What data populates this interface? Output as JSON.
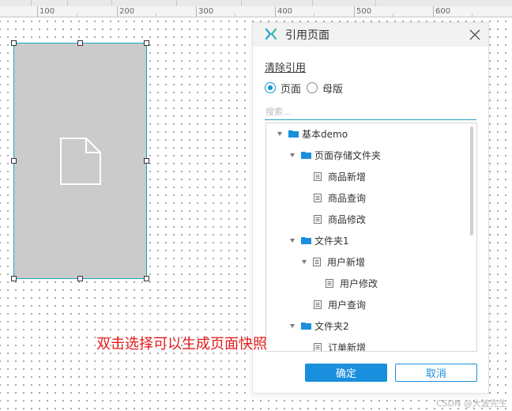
{
  "ruler": {
    "labels": [
      "100",
      "200",
      "300",
      "400",
      "500",
      "600"
    ]
  },
  "dialog": {
    "title": "引用页面",
    "clear_reference": "清除引用",
    "radios": [
      {
        "label": "页面",
        "checked": true
      },
      {
        "label": "母版",
        "checked": false
      }
    ],
    "search_placeholder": "搜索...",
    "tree": [
      {
        "label": "基本demo",
        "type": "folder",
        "depth": 0,
        "expanded": true
      },
      {
        "label": "页面存储文件夹",
        "type": "folder",
        "depth": 1,
        "expanded": true
      },
      {
        "label": "商品新增",
        "type": "page",
        "depth": 2
      },
      {
        "label": "商品查询",
        "type": "page",
        "depth": 2
      },
      {
        "label": "商品修改",
        "type": "page",
        "depth": 2
      },
      {
        "label": "文件夹1",
        "type": "folder",
        "depth": 1,
        "expanded": true
      },
      {
        "label": "用户新增",
        "type": "page",
        "depth": 2,
        "expanded": true
      },
      {
        "label": "用户修改",
        "type": "page",
        "depth": 3
      },
      {
        "label": "用户查询",
        "type": "page",
        "depth": 2
      },
      {
        "label": "文件夹2",
        "type": "folder",
        "depth": 1,
        "expanded": true
      },
      {
        "label": "订单新增",
        "type": "page",
        "depth": 2
      }
    ],
    "ok_label": "确定",
    "cancel_label": "取消",
    "accent_color": "#1a8fdd"
  },
  "annotation": "双击选择可以生成页面快照",
  "watermark": "CSDN @大波先生"
}
